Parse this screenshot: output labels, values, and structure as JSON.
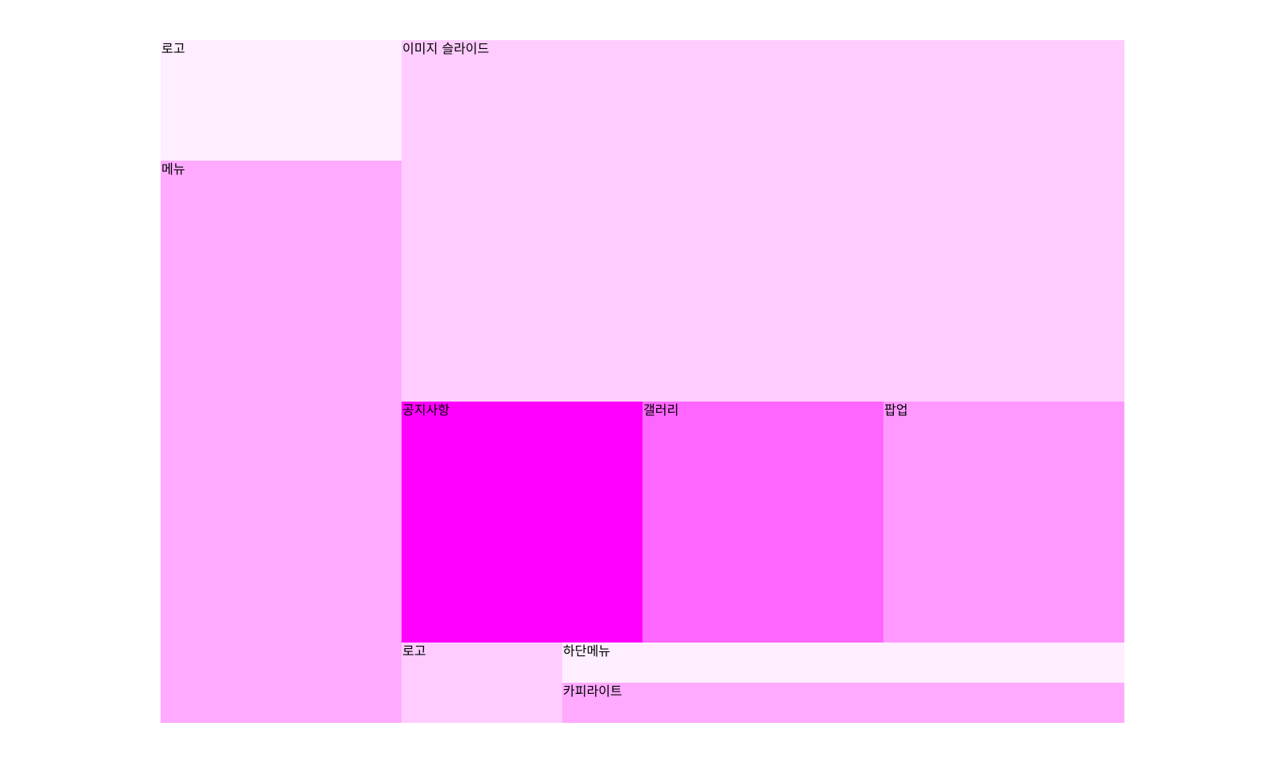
{
  "header": {
    "logo": {
      "label": "로고",
      "color": "#ffeeff"
    },
    "menu": {
      "label": "메뉴",
      "color": "#ffaaff"
    }
  },
  "slide": {
    "label": "이미지 슬라이드",
    "color": "#ffccff"
  },
  "contents": {
    "notice": {
      "label": "공지사항",
      "color": "#ff00ff"
    },
    "gallery": {
      "label": "갤러리",
      "color": "#ff66ff"
    },
    "popup": {
      "label": "팝업",
      "color": "#ff99ff"
    }
  },
  "footer": {
    "logo": {
      "label": "로고",
      "color": "#ffccff"
    },
    "menu": {
      "label": "하단메뉴",
      "color": "#ffeeff"
    },
    "copyright": {
      "label": "카피라이트",
      "color": "#ffaaff"
    }
  }
}
